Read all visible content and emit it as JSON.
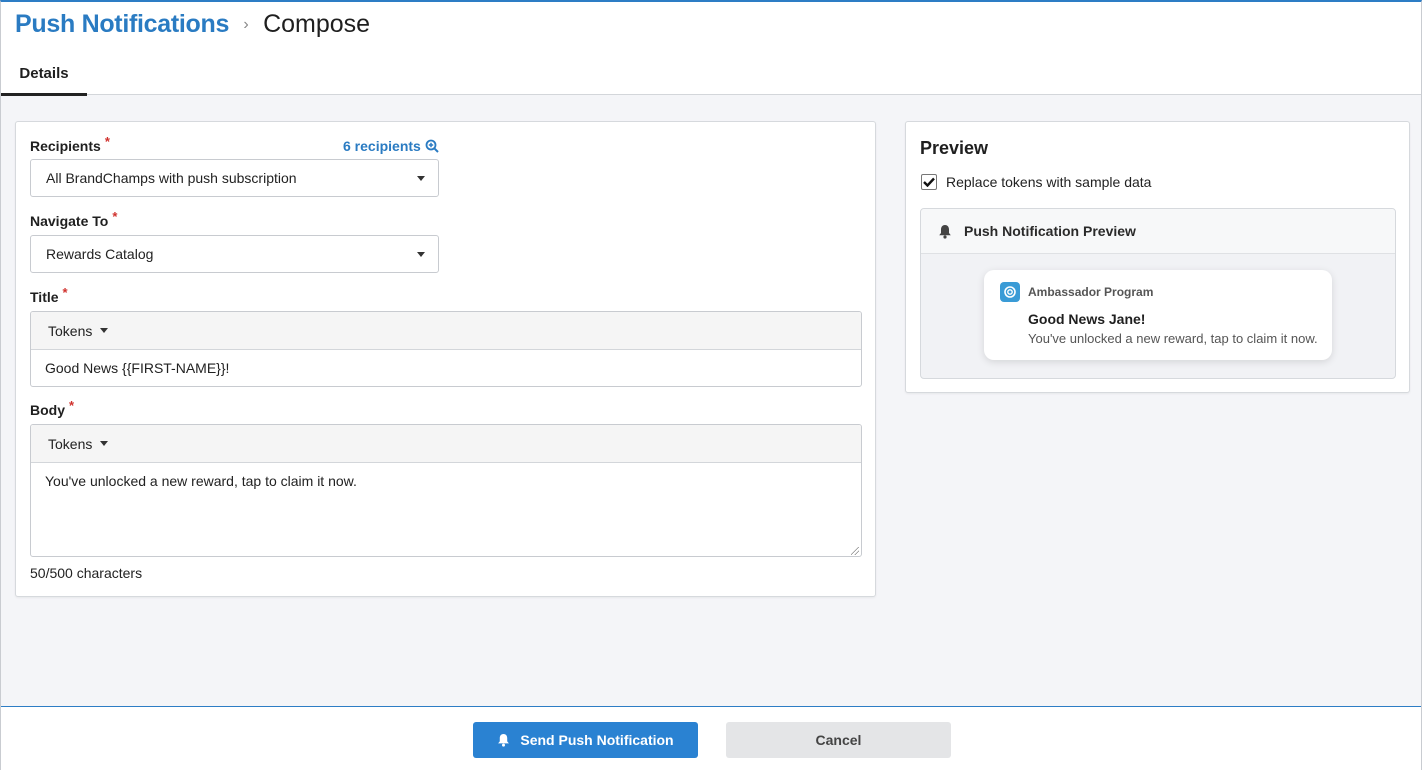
{
  "breadcrumb": {
    "parent": "Push Notifications",
    "separator": "›",
    "current": "Compose"
  },
  "tabs": [
    {
      "label": "Details",
      "active": true
    }
  ],
  "form": {
    "recipients": {
      "label": "Recipients",
      "required_mark": "*",
      "count_link": "6 recipients",
      "selected": "All BrandChamps with push subscription"
    },
    "navigate_to": {
      "label": "Navigate To",
      "required_mark": "*",
      "selected": "Rewards Catalog"
    },
    "title": {
      "label": "Title",
      "required_mark": "*",
      "tokens_label": "Tokens",
      "value": "Good News {{FIRST-NAME}}!"
    },
    "body": {
      "label": "Body",
      "required_mark": "*",
      "tokens_label": "Tokens",
      "value": "You've unlocked a new reward, tap to claim it now.",
      "counter": "50/500 characters"
    }
  },
  "preview": {
    "heading": "Preview",
    "replace_tokens": {
      "label": "Replace tokens with sample data",
      "checked": true
    },
    "panel_title": "Push Notification Preview",
    "notification": {
      "app_name": "Ambassador Program",
      "title": "Good News Jane!",
      "body": "You've unlocked a new reward, tap to claim it now."
    }
  },
  "footer": {
    "send_label": "Send Push Notification",
    "cancel_label": "Cancel"
  },
  "colors": {
    "accent": "#2a82d2",
    "link": "#2a7bc2",
    "required": "#d0312d"
  }
}
